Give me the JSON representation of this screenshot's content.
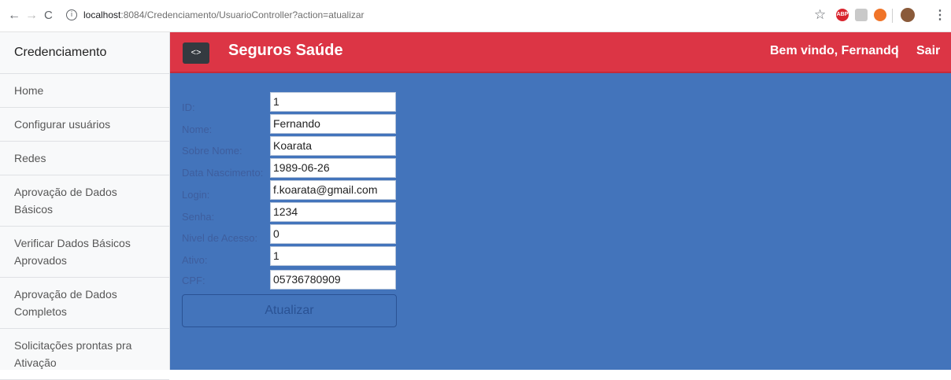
{
  "browser": {
    "url_host": "localhost",
    "url_rest": ":8084/Credenciamento/UsuarioController?action=atualizar",
    "ext_abp": "ABP"
  },
  "sidebar": {
    "title": "Credenciamento",
    "items": [
      {
        "label": "Home"
      },
      {
        "label": "Configurar usuários"
      },
      {
        "label": "Redes"
      },
      {
        "label": "Aprovação de Dados Básicos"
      },
      {
        "label": "Verificar Dados Básicos Aprovados"
      },
      {
        "label": "Aprovação de Dados Completos"
      },
      {
        "label": "Solicitações prontas pra Ativação"
      }
    ]
  },
  "header": {
    "toggle_label": "<>",
    "brand": "Seguros Saúde",
    "welcome": "Bem vindo, Fernando",
    "separator": "|",
    "logout": "Sair"
  },
  "form": {
    "fields": [
      {
        "label": "ID:",
        "value": "1"
      },
      {
        "label": "Nome:",
        "value": "Fernando"
      },
      {
        "label": "Sobre Nome:",
        "value": "Koarata"
      },
      {
        "label": "Data Nascimento:",
        "value": "1989-06-26"
      },
      {
        "label": "Login:",
        "value": "f.koarata@gmail.com"
      },
      {
        "label": "Senha:",
        "value": "1234"
      },
      {
        "label": "Nivel de Acesso:",
        "value": "0"
      },
      {
        "label": "Ativo:",
        "value": "1"
      },
      {
        "label": "CPF:",
        "value": "05736780909"
      }
    ],
    "submit_label": "Atualizar"
  },
  "colors": {
    "header_bg": "#dc3545",
    "content_bg": "#4374bb",
    "sidebar_bg": "#f8f9fa"
  }
}
